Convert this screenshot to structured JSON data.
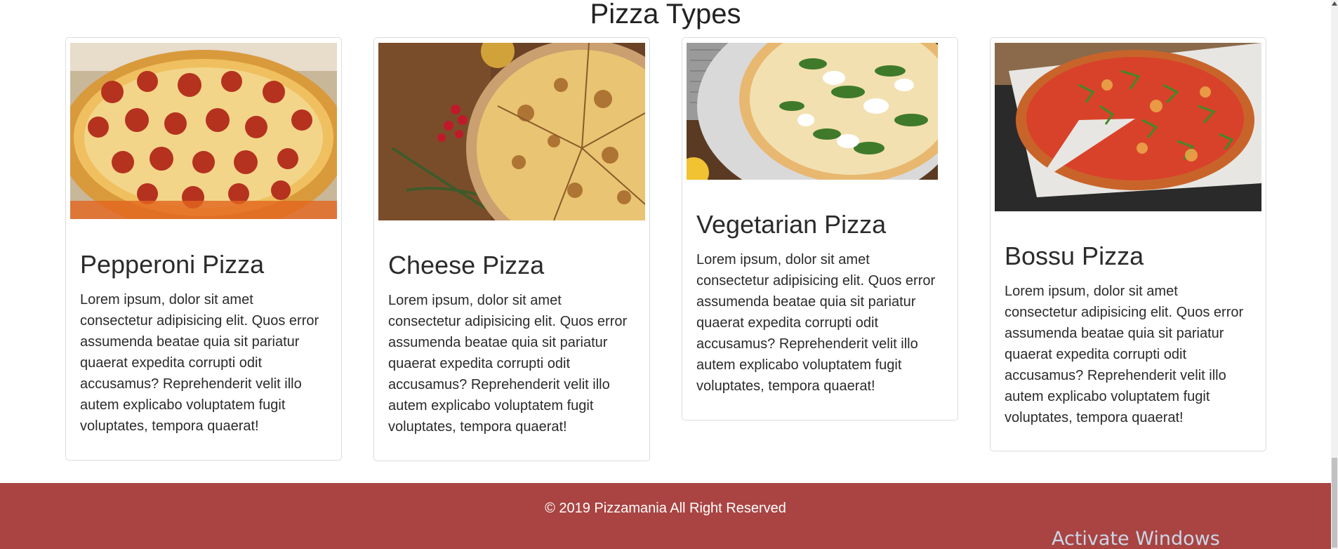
{
  "section": {
    "title": "Pizza Types"
  },
  "cards": [
    {
      "title": "Pepperoni Pizza",
      "text": "Lorem ipsum, dolor sit amet consectetur adipisicing elit. Quos error assumenda beatae quia sit pariatur quaerat expedita corrupti odit accusamus? Reprehenderit velit illo autem explicabo voluptatem fugit voluptates, tempora quaerat!",
      "image_icon": "pepperoni-pizza-photo"
    },
    {
      "title": "Cheese Pizza",
      "text": "Lorem ipsum, dolor sit amet consectetur adipisicing elit. Quos error assumenda beatae quia sit pariatur quaerat expedita corrupti odit accusamus? Reprehenderit velit illo autem explicabo voluptatem fugit voluptates, tempora quaerat!",
      "image_icon": "cheese-pizza-photo"
    },
    {
      "title": "Vegetarian Pizza",
      "text": "Lorem ipsum, dolor sit amet consectetur adipisicing elit. Quos error assumenda beatae quia sit pariatur quaerat expedita corrupti odit accusamus? Reprehenderit velit illo autem explicabo voluptatem fugit voluptates, tempora quaerat!",
      "image_icon": "vegetarian-pizza-photo"
    },
    {
      "title": "Bossu Pizza",
      "text": "Lorem ipsum, dolor sit amet consectetur adipisicing elit. Quos error assumenda beatae quia sit pariatur quaerat expedita corrupti odit accusamus? Reprehenderit velit illo autem explicabo voluptatem fugit voluptates, tempora quaerat!",
      "image_icon": "bossu-pizza-photo"
    }
  ],
  "footer": {
    "text": "© 2019 Pizzamania All Right Reserved"
  },
  "watermark": {
    "text": "Activate Windows"
  },
  "colors": {
    "footer_bg": "#a94442",
    "card_border": "#dcdcdc",
    "text": "#2b2b2b"
  }
}
